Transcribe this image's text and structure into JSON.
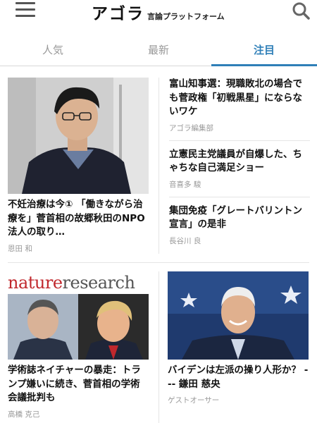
{
  "header": {
    "logo_main": "アゴラ",
    "logo_sub": "言論プラットフォーム",
    "menu_icon": "hamburger-menu-icon",
    "search_icon": "search-icon"
  },
  "tabs": [
    {
      "label": "人気",
      "active": false
    },
    {
      "label": "最新",
      "active": false
    },
    {
      "label": "注目",
      "active": true
    }
  ],
  "feature": {
    "title": "不妊治療は今① 「働きながら治療を」菅首相の故郷秋田のNPO法人の取り…",
    "author": "恩田 和"
  },
  "side_articles": [
    {
      "title": "富山知事選：現職敗北の場合でも菅政権「初戦黒星」にならないワケ",
      "author": "アゴラ編集部"
    },
    {
      "title": "立憲民主党議員が自爆した、ちゃちな自己満足ショー",
      "author": "音喜多 駿"
    },
    {
      "title": "集団免疫「グレートバリントン宣言」の是非",
      "author": "長谷川 良"
    }
  ],
  "cards": [
    {
      "title": "学術誌ネイチャーの暴走：トランプ嫌いに続き、菅首相の学術会議批判も",
      "author": "高橋 克己",
      "banner_part1": "nature",
      "banner_part2": "research"
    },
    {
      "title": "バイデンは左派の操り人形か？ --- 鎌田 慈央",
      "author": "ゲストオーサー"
    }
  ],
  "colors": {
    "accent": "#2f7fb8",
    "muted": "#999999"
  }
}
